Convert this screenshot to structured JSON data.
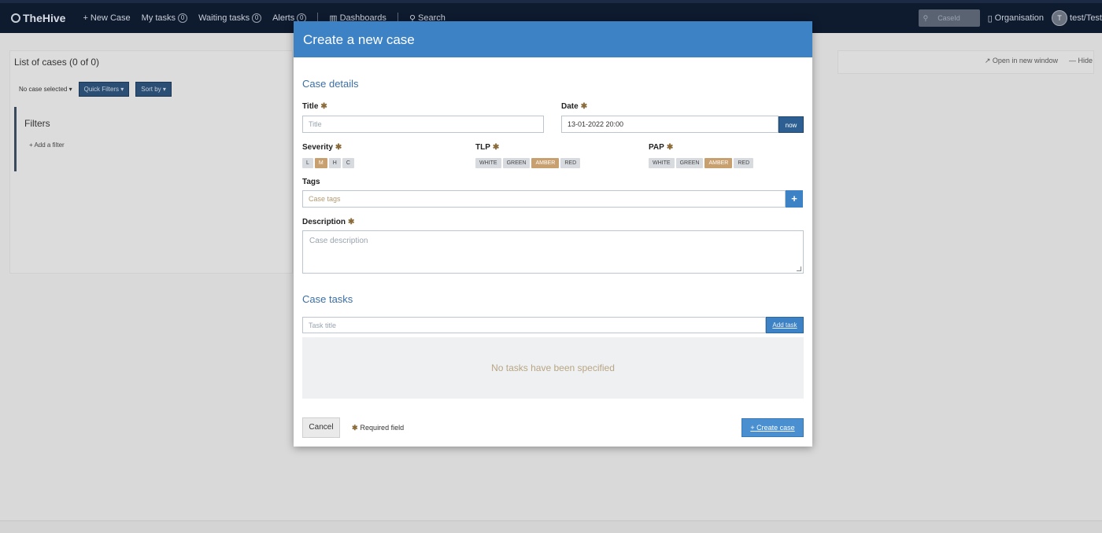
{
  "navbar": {
    "brand": "TheHive",
    "items": [
      {
        "label": "New Case",
        "icon": "plus-icon"
      },
      {
        "label": "My tasks",
        "badge": "0"
      },
      {
        "label": "Waiting tasks",
        "badge": "0"
      },
      {
        "label": "Alerts",
        "badge": "0"
      },
      {
        "label": "Dashboards",
        "icon": "chart-icon"
      },
      {
        "label": "Search",
        "icon": "search-icon"
      }
    ],
    "caseid_placeholder": "CaseId",
    "organisation": "Organisation",
    "avatar_initial": "T",
    "user": "test/Test"
  },
  "background": {
    "list_title": "List of cases  (0 of 0)",
    "no_case_selected": "No case selected ▾",
    "quick_filters": "Quick Filters ▾",
    "sort_by": "Sort by ▾",
    "filters_title": "Filters",
    "add_filter": "+ Add a filter",
    "open_new_window": "Open in new window",
    "hide": "Hide"
  },
  "modal": {
    "title": "Create a new case",
    "case_details_title": "Case details",
    "title_label": "Title",
    "title_placeholder": "Title",
    "date_label": "Date",
    "date_value": "13-01-2022 20:00",
    "now_label": "now",
    "severity_label": "Severity",
    "severity_options": [
      "L",
      "M",
      "H",
      "C"
    ],
    "severity_selected": "M",
    "tlp_label": "TLP",
    "tlp_options": [
      "WHITE",
      "GREEN",
      "AMBER",
      "RED"
    ],
    "tlp_selected": "AMBER",
    "pap_label": "PAP",
    "pap_options": [
      "WHITE",
      "GREEN",
      "AMBER",
      "RED"
    ],
    "pap_selected": "AMBER",
    "tags_label": "Tags",
    "tags_placeholder": "Case tags",
    "description_label": "Description",
    "description_placeholder": "Case description",
    "case_tasks_title": "Case tasks",
    "task_title_placeholder": "Task title",
    "add_task_label": "Add task",
    "no_tasks_text": "No tasks have been specified",
    "cancel_label": "Cancel",
    "required_field_label": "Required field",
    "create_case_label": "Create case",
    "required_marker": "✱"
  },
  "colors": {
    "navbar_bg": "#0e1a2e",
    "modal_header": "#3c82c4",
    "amber_selected": "#c89f6e",
    "section_title": "#3c6fa5"
  }
}
